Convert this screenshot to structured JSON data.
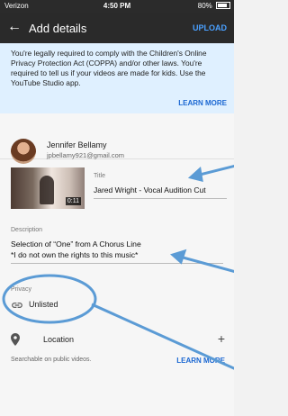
{
  "status_bar": {
    "carrier": "Verizon",
    "time": "4:50 PM",
    "battery": "80%"
  },
  "app_bar": {
    "title": "Add details",
    "upload_label": "UPLOAD"
  },
  "coppa_notice": {
    "text": "You're legally required to comply with the Children's Online Privacy Protection Act (COPPA) and/or other laws. You're required to tell us if your videos are made for kids. Use the YouTube Studio app.",
    "learn_more": "LEARN MORE"
  },
  "account": {
    "name": "Jennifer Bellamy",
    "email": "jpbellamy921@gmail.com"
  },
  "video": {
    "duration": "0:11",
    "title_label": "Title",
    "title_value": "Jared Wright - Vocal Audition Cut"
  },
  "description": {
    "label": "Description",
    "line1": "Selection of “One” from A Chorus Line",
    "line2": "*I do not own the rights to this music*"
  },
  "privacy": {
    "label": "Privacy",
    "value": "Unlisted"
  },
  "location": {
    "label": "Location",
    "add_icon": "+"
  },
  "search_note": {
    "text": "Searchable on public videos.",
    "learn_more": "LEARN MORE"
  },
  "icons": {
    "back": "back-arrow-icon",
    "link": "link-icon",
    "location": "location-pin-icon",
    "add": "plus-icon"
  },
  "colors": {
    "appbar": "#2a2a2a",
    "accent": "#1a67d2",
    "notice_bg": "#dff0ff",
    "annotation": "#5b9bd5"
  }
}
